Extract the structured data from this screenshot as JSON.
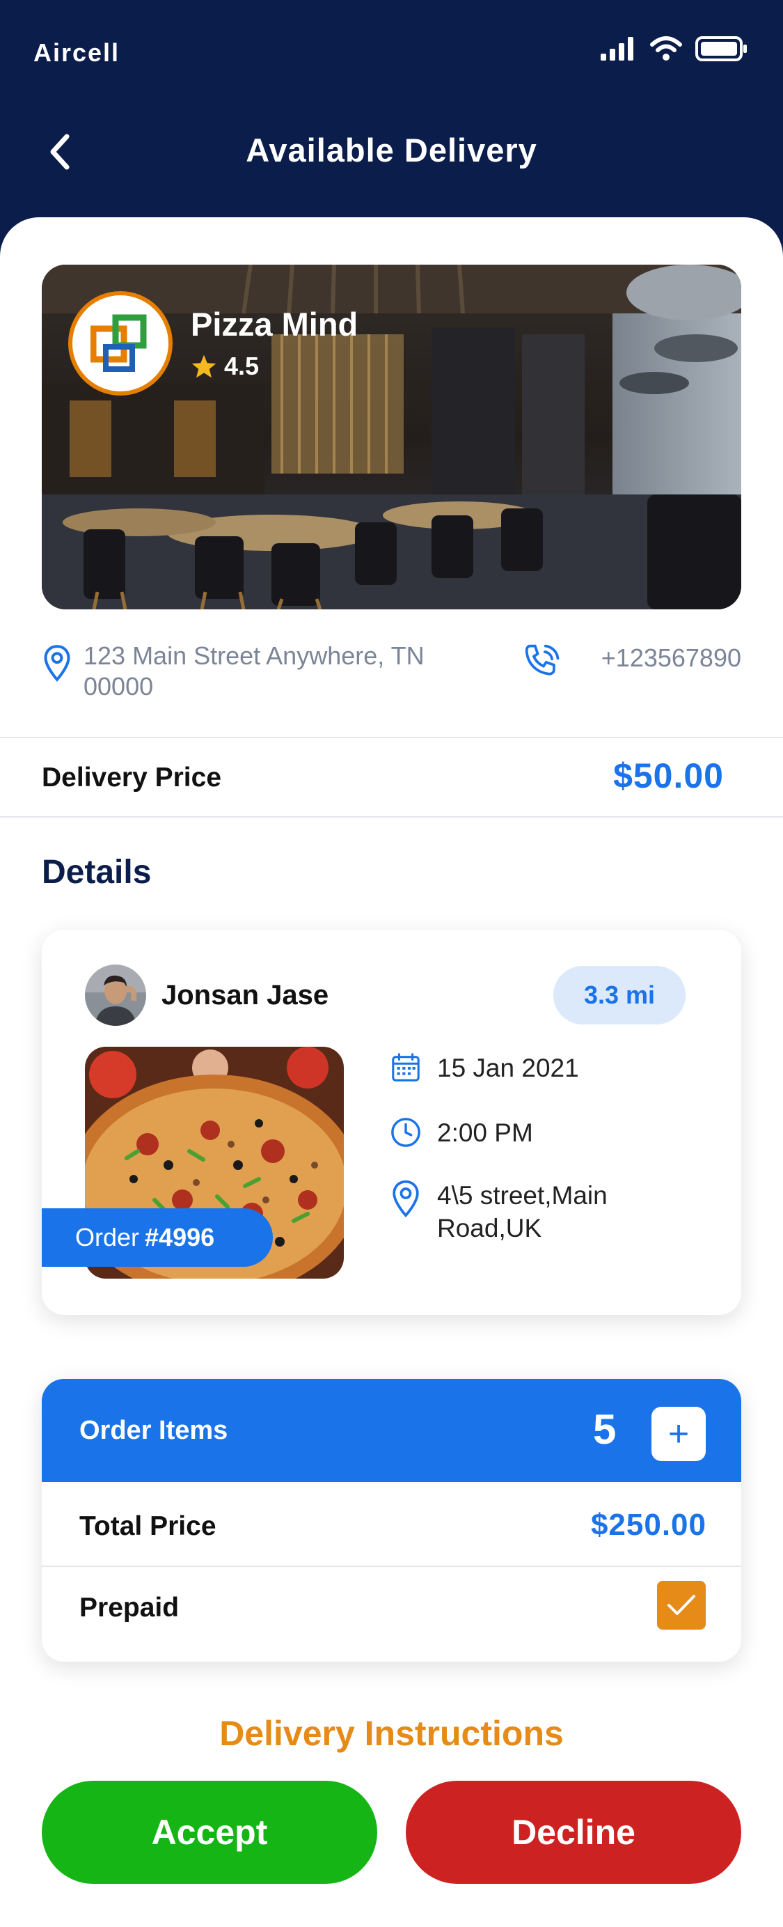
{
  "status_bar": {
    "carrier": "Aircell"
  },
  "header": {
    "title": "Available Delivery"
  },
  "restaurant": {
    "name": "Pizza Mind",
    "rating": "4.5",
    "address": "123 Main Street Anywhere, TN 00000",
    "phone": "+123567890"
  },
  "delivery_price": {
    "label": "Delivery Price",
    "value": "$50.00"
  },
  "details": {
    "title": "Details",
    "customer_name": "Jonsan Jase",
    "distance": "3.3 mi",
    "order_prefix": "Order",
    "order_number": "#4996",
    "date": "15 Jan 2021",
    "time": "2:00 PM",
    "location": "4\\5 street,Main Road,UK"
  },
  "order_items": {
    "label": "Order Items",
    "count": "5",
    "add_symbol": "+",
    "total_label": "Total Price",
    "total_value": "$250.00",
    "prepaid_label": "Prepaid",
    "prepaid_checked": true
  },
  "instructions_label": "Delivery Instructions",
  "actions": {
    "accept": "Accept",
    "decline": "Decline"
  },
  "colors": {
    "navy": "#0b1d4a",
    "accent_blue": "#1a73e8",
    "orange": "#e68a18",
    "accept_green": "#15b515",
    "decline_red": "#cc2222"
  }
}
